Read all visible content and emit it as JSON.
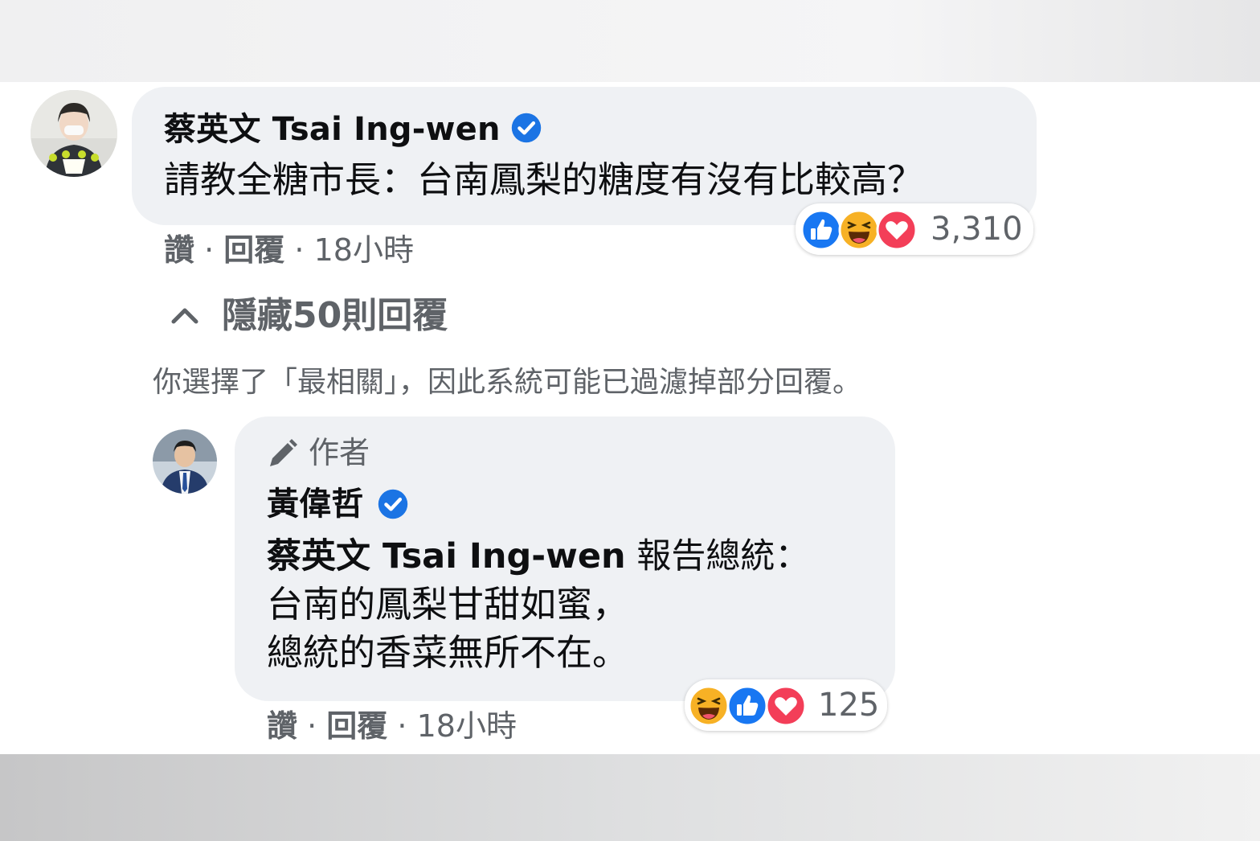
{
  "comment": {
    "author": "蔡英文 Tsai Ing-wen",
    "text": "請教全糖市長：台南鳳梨的糖度有沒有比較高？",
    "reaction_count": "3,310",
    "reaction_icons": [
      "like-icon",
      "haha-icon",
      "love-icon"
    ],
    "actions": {
      "like": "讚",
      "reply": "回覆",
      "time": "18小時",
      "sep": "·"
    }
  },
  "hide_replies": {
    "label": "隱藏50則回覆",
    "icon": "chevron-up-icon"
  },
  "filter_notice": "你選擇了「最相關」，因此系統可能已過濾掉部分回覆。",
  "reply": {
    "badge": "作者",
    "badge_icon": "pencil-icon",
    "author": "黃偉哲",
    "mention": "蔡英文 Tsai Ing-wen",
    "line1_rest": " 報告總統：",
    "line2": "台南的鳳梨甘甜如蜜，",
    "line3": "總統的香菜無所不在。",
    "reaction_count": "125",
    "reaction_icons": [
      "haha-icon",
      "like-icon",
      "love-icon"
    ],
    "actions": {
      "like": "讚",
      "reply": "回覆",
      "time": "18小時",
      "sep": "·"
    }
  },
  "colors": {
    "bubble": "#eff1f4",
    "verified": "#1b74e4",
    "like": "#1877f2",
    "love": "#f33e58",
    "haha": "#f7b125"
  }
}
